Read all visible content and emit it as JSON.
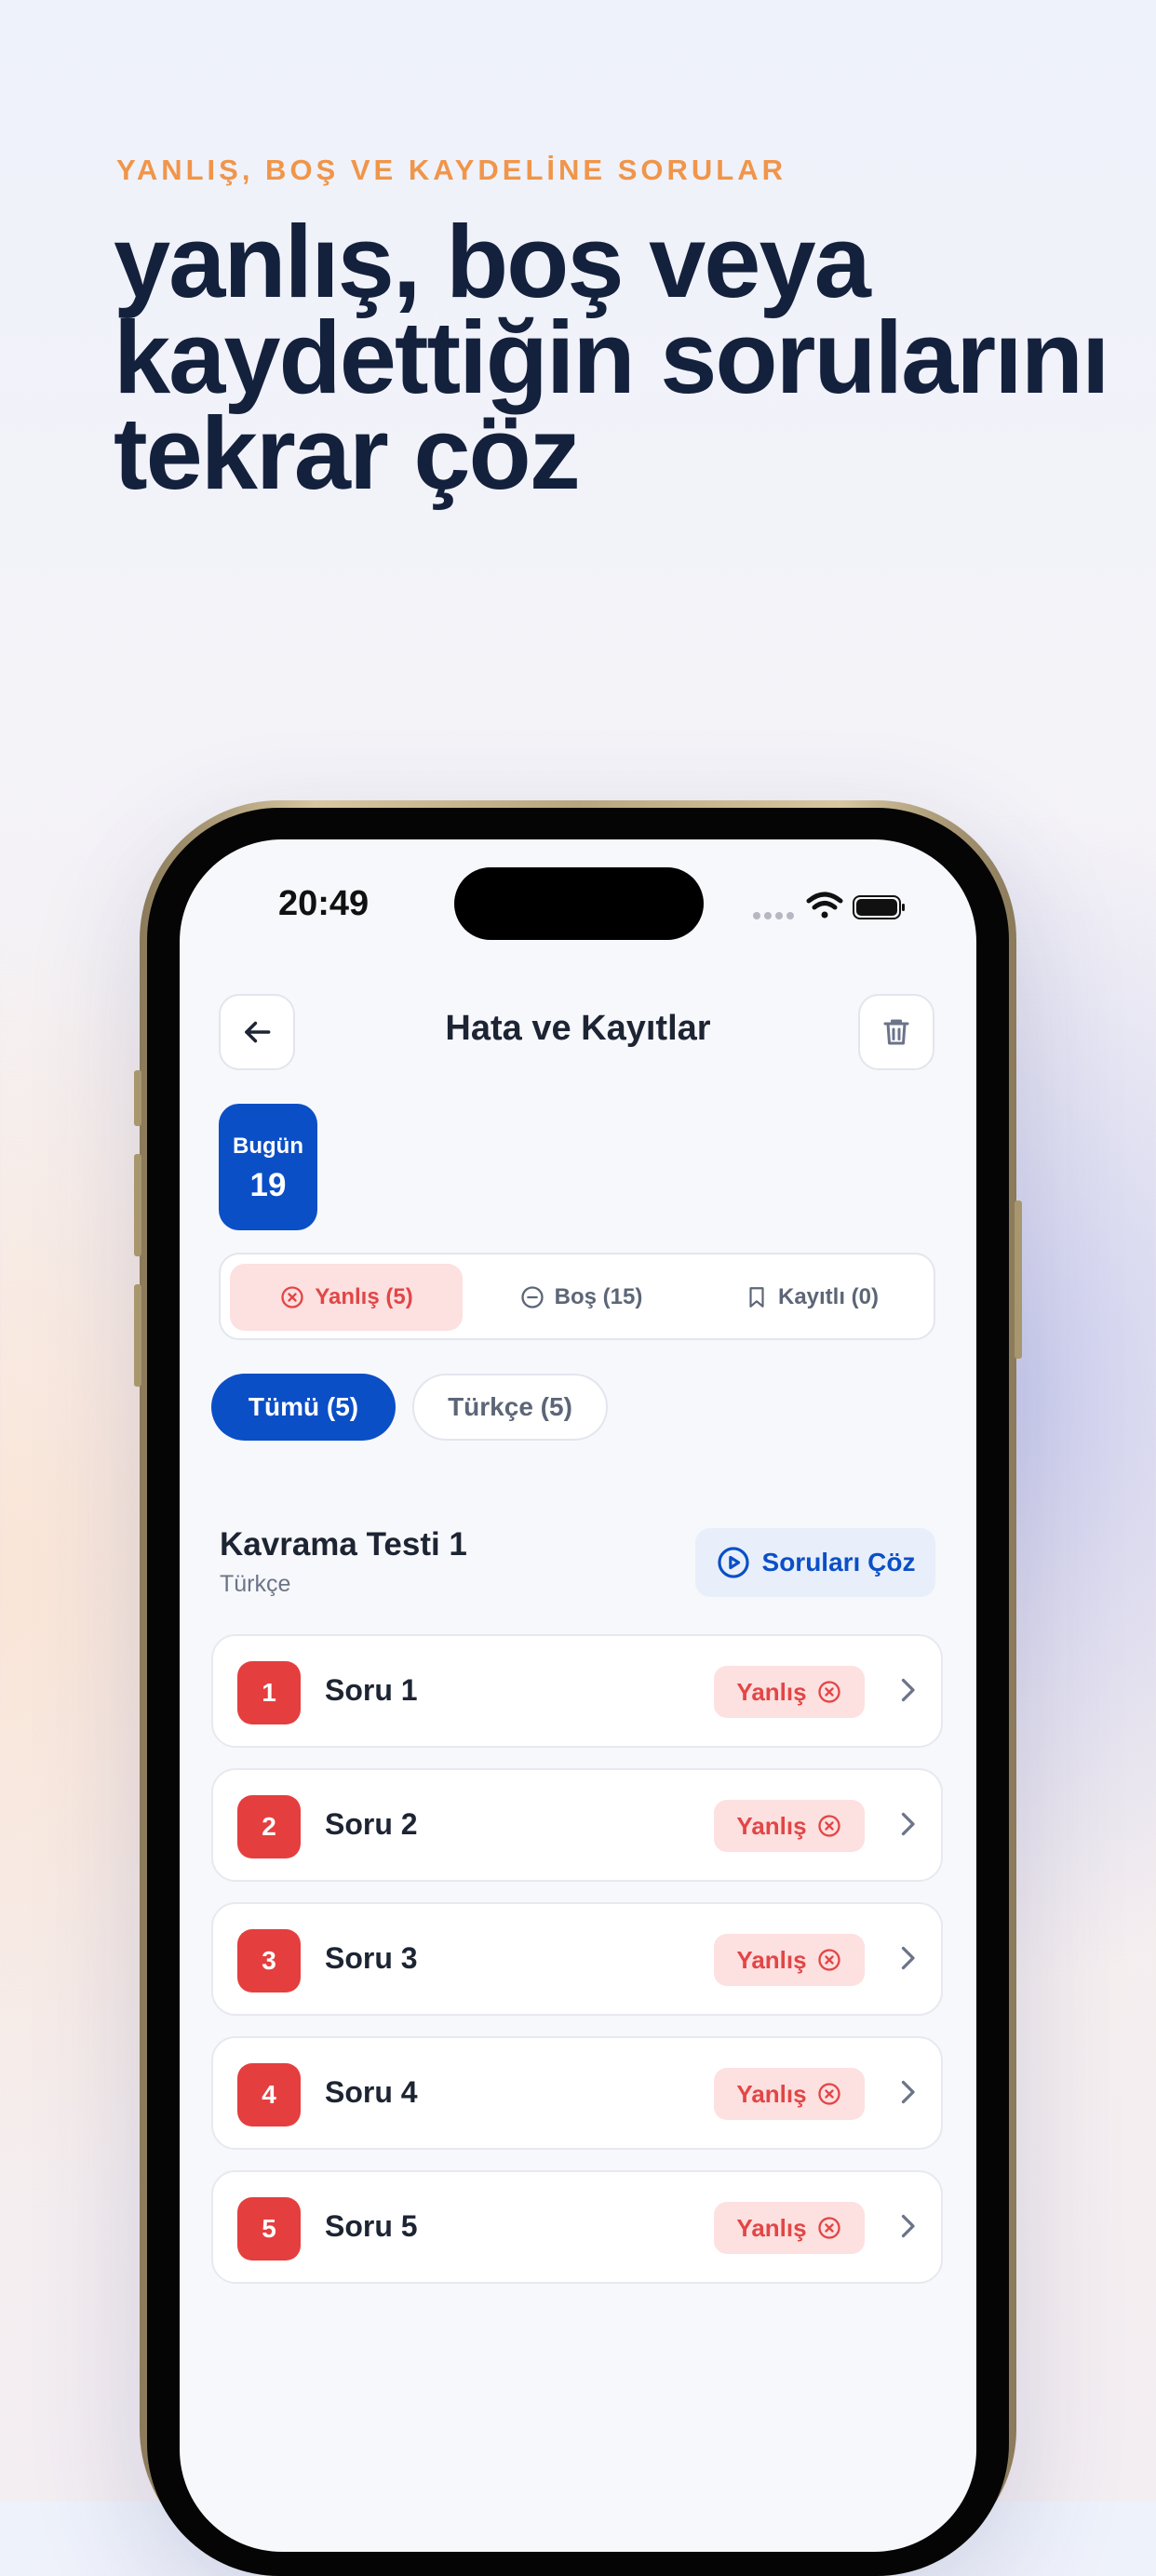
{
  "promo": {
    "eyebrow": "YANLIŞ, BOŞ VE KAYDELİNE SORULAR",
    "headline": "yanlış, boş veya kaydettiğin sorularını tekrar çöz"
  },
  "status_bar": {
    "time": "20:49"
  },
  "header": {
    "title": "Hata ve Kayıtlar",
    "back_icon": "arrow-left-icon",
    "delete_icon": "trash-icon"
  },
  "date_badge": {
    "label": "Bugün",
    "day": "19"
  },
  "segments": [
    {
      "label": "Yanlış (5)",
      "icon": "x-circle-icon",
      "active": true
    },
    {
      "label": "Boş (15)",
      "icon": "minus-circle-icon",
      "active": false
    },
    {
      "label": "Kayıtlı (0)",
      "icon": "bookmark-icon",
      "active": false
    }
  ],
  "filters": [
    {
      "label": "Tümü (5)",
      "active": true
    },
    {
      "label": "Türkçe (5)",
      "active": false
    }
  ],
  "section": {
    "title": "Kavrama Testi 1",
    "subtitle": "Türkçe",
    "solve_label": "Soruları Çöz"
  },
  "questions": [
    {
      "number": "1",
      "title": "Soru 1",
      "status": "Yanlış"
    },
    {
      "number": "2",
      "title": "Soru 2",
      "status": "Yanlış"
    },
    {
      "number": "3",
      "title": "Soru 3",
      "status": "Yanlış"
    },
    {
      "number": "4",
      "title": "Soru 4",
      "status": "Yanlış"
    },
    {
      "number": "5",
      "title": "Soru 5",
      "status": "Yanlış"
    }
  ],
  "colors": {
    "accent": "#0b4fc7",
    "error": "#e53e3e",
    "error_bg": "#fde0e0",
    "eyebrow": "#f0954a",
    "headline": "#14213d"
  }
}
